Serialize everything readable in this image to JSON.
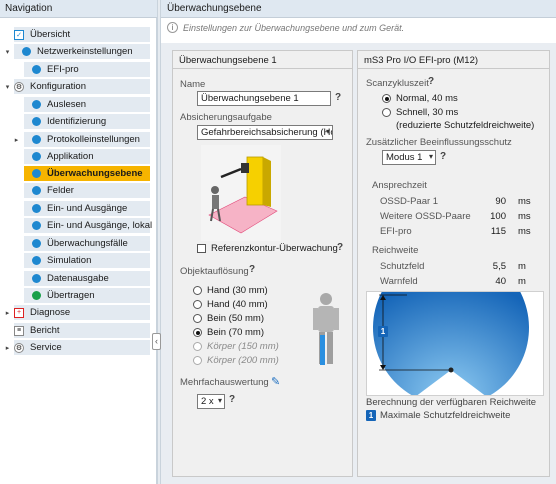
{
  "navigation": {
    "title": "Navigation",
    "items": [
      {
        "label": "Übersicht"
      },
      {
        "label": "Netzwerkeinstellungen"
      },
      {
        "label": "EFI-pro"
      },
      {
        "label": "Konfiguration"
      },
      {
        "label": "Auslesen"
      },
      {
        "label": "Identifizierung"
      },
      {
        "label": "Protokolleinstellungen"
      },
      {
        "label": "Applikation"
      },
      {
        "label": "Überwachungsebene"
      },
      {
        "label": "Felder"
      },
      {
        "label": "Ein- und Ausgänge"
      },
      {
        "label": "Ein- und Ausgänge, lokal"
      },
      {
        "label": "Überwachungsfälle"
      },
      {
        "label": "Simulation"
      },
      {
        "label": "Datenausgabe"
      },
      {
        "label": "Übertragen"
      },
      {
        "label": "Diagnose"
      },
      {
        "label": "Bericht"
      },
      {
        "label": "Service"
      }
    ]
  },
  "main": {
    "title": "Überwachungsebene",
    "info": "Einstellungen zur Überwachungsebene und zum Gerät."
  },
  "left_panel": {
    "title": "Überwachungsebene 1",
    "name_label": "Name",
    "name_value": "Überwachungsebene 1",
    "task_label": "Absicherungsaufgabe",
    "task_value": "Gefahrbereichsabsicherung (Ho",
    "contour_label": "Referenzkontur-Überwachung",
    "resolution_label": "Objektauflösung",
    "resolution_options": [
      {
        "label": "Hand (30 mm)",
        "selected": false,
        "enabled": true
      },
      {
        "label": "Hand (40 mm)",
        "selected": false,
        "enabled": true
      },
      {
        "label": "Bein (50 mm)",
        "selected": false,
        "enabled": true
      },
      {
        "label": "Bein (70 mm)",
        "selected": true,
        "enabled": true
      },
      {
        "label": "Körper (150 mm)",
        "selected": false,
        "enabled": false
      },
      {
        "label": "Körper (200 mm)",
        "selected": false,
        "enabled": false
      }
    ],
    "multi_label": "Mehrfachauswertung",
    "multi_value": "2 x"
  },
  "right_panel": {
    "title": "mS3 Pro I/O EFI-pro (M12)",
    "scan_label": "Scanzykluszeit",
    "scan_options": [
      {
        "label": "Normal, 40 ms",
        "selected": true
      },
      {
        "label": "Schnell, 30 ms",
        "selected": false
      },
      {
        "label": "(reduzierte Schutzfeldreichweite)",
        "selected": false
      }
    ],
    "protection_label": "Zusätzlicher Beeinflussungsschutz",
    "protection_value": "Modus 1",
    "response_label": "Ansprechzeit",
    "response_rows": [
      {
        "label": "OSSD-Paar 1",
        "value": "90",
        "unit": "ms"
      },
      {
        "label": "Weitere OSSD-Paare",
        "value": "100",
        "unit": "ms"
      },
      {
        "label": "EFI-pro",
        "value": "115",
        "unit": "ms"
      }
    ],
    "range_label": "Reichweite",
    "range_rows": [
      {
        "label": "Schutzfeld",
        "value": "5,5",
        "unit": "m"
      },
      {
        "label": "Warnfeld",
        "value": "40",
        "unit": "m"
      }
    ],
    "diagram_marker": "1",
    "range_note": "Berechnung der verfügbaren Reichweite",
    "legend_marker": "1",
    "legend_text": "Maximale Schutzfeldreichweite"
  },
  "colors": {
    "accent": "#f6b400",
    "nav_bg": "#e3eaf1",
    "status_dot": "#1e88d0",
    "ok_dot": "#19a04a",
    "field_blue": "#1976c8"
  },
  "icons": [
    "overview-icon",
    "gear-icon",
    "diagnosis-icon",
    "report-icon",
    "service-icon",
    "edit-pencil-icon",
    "help-icon",
    "info-icon"
  ]
}
